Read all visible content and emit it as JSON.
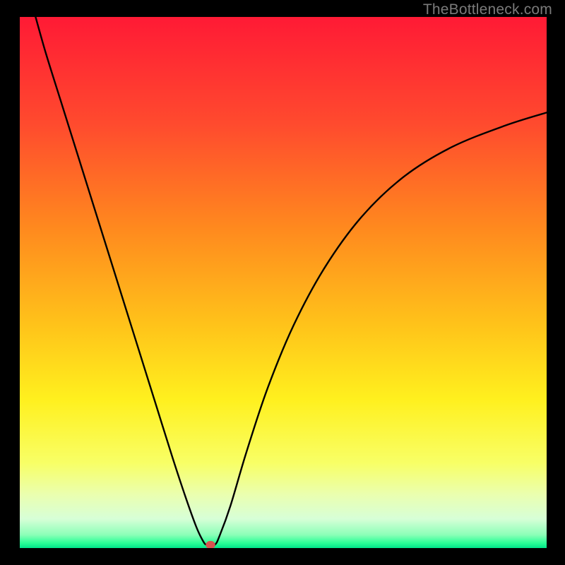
{
  "watermark": "TheBottleneck.com",
  "chart_data": {
    "type": "line",
    "title": "",
    "xlabel": "",
    "ylabel": "",
    "xlim": [
      0,
      100
    ],
    "ylim": [
      0,
      100
    ],
    "gradient_stops": [
      {
        "offset": 0,
        "color": "#ff1a35"
      },
      {
        "offset": 0.2,
        "color": "#ff4a2e"
      },
      {
        "offset": 0.4,
        "color": "#ff8a1e"
      },
      {
        "offset": 0.58,
        "color": "#ffc31a"
      },
      {
        "offset": 0.72,
        "color": "#fff01e"
      },
      {
        "offset": 0.84,
        "color": "#f8ff66"
      },
      {
        "offset": 0.9,
        "color": "#eaffb0"
      },
      {
        "offset": 0.945,
        "color": "#d7ffd7"
      },
      {
        "offset": 0.975,
        "color": "#8cffb8"
      },
      {
        "offset": 0.99,
        "color": "#2dff97"
      },
      {
        "offset": 1.0,
        "color": "#00e58a"
      }
    ],
    "series": [
      {
        "name": "bottleneck-curve",
        "x": [
          3,
          5,
          8,
          11,
          14,
          17,
          20,
          23,
          26,
          29,
          31.5,
          33.5,
          34.8,
          35.5,
          37,
          38,
          40,
          43,
          47,
          52,
          58,
          65,
          73,
          82,
          92,
          100
        ],
        "y": [
          100,
          93,
          83.5,
          74,
          64.5,
          55,
          45.5,
          36,
          26.5,
          17,
          9.5,
          4,
          1.3,
          0.6,
          0.6,
          2.5,
          8,
          18,
          30,
          42,
          53,
          62.5,
          70,
          75.5,
          79.5,
          82
        ]
      }
    ],
    "marker": {
      "x": 36.2,
      "y": 0.6,
      "rx": 0.9,
      "ry": 0.75,
      "color": "#d7534f"
    }
  }
}
